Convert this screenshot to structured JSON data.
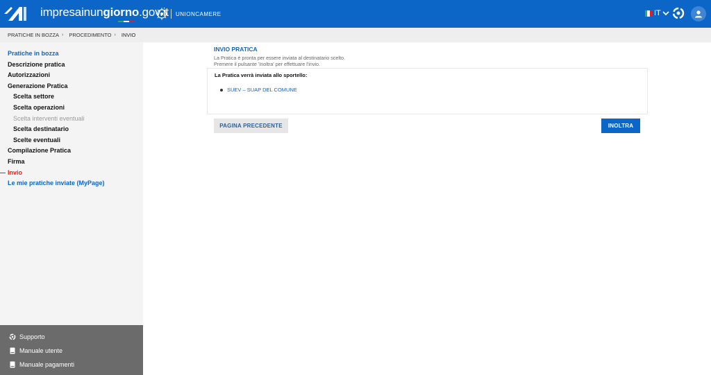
{
  "header": {
    "brand_regular": "impresainun",
    "brand_bold": "giorno",
    "brand_suffix": ".gov.it",
    "partner": "UNIONCAMERE",
    "language": "IT",
    "colors": {
      "bar": "#0b66c8",
      "accent_red": "#e4231b"
    }
  },
  "breadcrumb": {
    "items": [
      "PRATICHE IN BOZZA",
      "PROCEDIMENTO",
      "INVIO"
    ]
  },
  "sidebar": {
    "items": [
      {
        "label": "Pratiche in bozza"
      },
      {
        "label": "Descrizione pratica"
      },
      {
        "label": "Autorizzazioni"
      },
      {
        "label": "Generazione Pratica"
      },
      {
        "label": "Scelta settore"
      },
      {
        "label": "Scelta operazioni"
      },
      {
        "label": "Scelta interventi eventuali"
      },
      {
        "label": "Scelta destinatario"
      },
      {
        "label": "Scelte eventuali"
      },
      {
        "label": "Compilazione Pratica"
      },
      {
        "label": "Firma"
      },
      {
        "label": "Invio"
      },
      {
        "label": "Le mie pratiche inviate (MyPage)"
      }
    ],
    "support": [
      {
        "label": "Supporto",
        "icon": "support-icon"
      },
      {
        "label": "Manuale utente",
        "icon": "book-icon"
      },
      {
        "label": "Manuale pagamenti",
        "icon": "book-icon"
      }
    ]
  },
  "main": {
    "title": "INVIO PRATICA",
    "desc_line1": "La Pratica è pronta per essere inviata al destinatario scelto.",
    "desc_line2": "Premere il pulsante 'Inoltra' per effettuare l'invio.",
    "panel_label": "La Pratica verrà inviata allo sportello:",
    "destination": "SUEV – SUAP DEL COMUNE",
    "btn_prev": "PAGINA PRECEDENTE",
    "btn_send": "INOLTRA"
  }
}
